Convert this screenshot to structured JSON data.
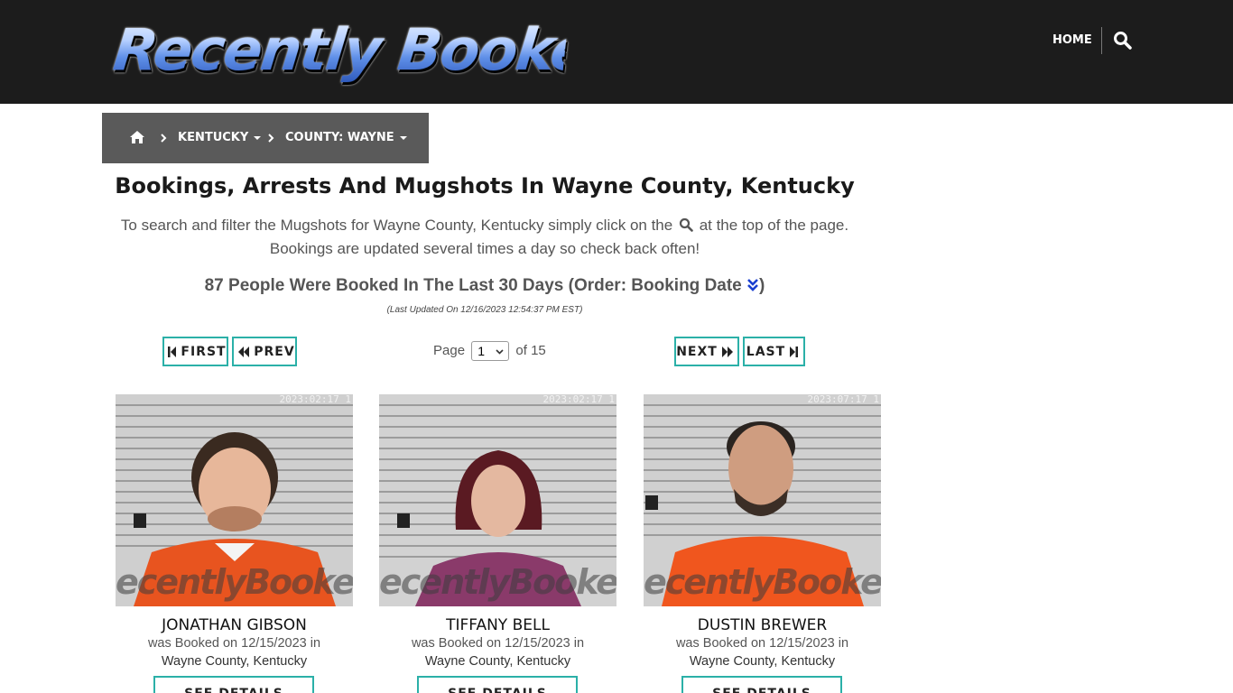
{
  "site": {
    "logo_text": "Recently Booked",
    "nav_home": "HOME"
  },
  "breadcrumb": {
    "state": "KENTUCKY",
    "county": "COUNTY: WAYNE"
  },
  "page": {
    "title": "Bookings, Arrests And Mugshots In Wayne County, Kentucky",
    "intro_part1": "To search and filter the Mugshots for Wayne County, Kentucky simply click on the",
    "intro_part2": "at the top of the page.",
    "intro_line2": "Bookings are updated several times a day so check back often!",
    "count_text": "87 People Were Booked In The Last 30 Days (Order: Booking Date",
    "count_close": ")",
    "last_updated": "(Last Updated On 12/16/2023 12:54:37 PM EST)"
  },
  "pager": {
    "first": "FIRST",
    "prev": "PREV",
    "next": "NEXT",
    "last": "LAST",
    "page_label": "Page",
    "current_page": "1",
    "of_label": "of 15"
  },
  "bookings": [
    {
      "name": "JONATHAN GIBSON",
      "booked_line": "was Booked on 12/15/2023 in",
      "location": "Wayne County, Kentucky",
      "details_label": "SEE DETAILS",
      "watermark": "ecentlyBooked.co",
      "timestamp": "2023:02:17 1",
      "shirt_color": "#e8541f"
    },
    {
      "name": "TIFFANY BELL",
      "booked_line": "was Booked on 12/15/2023 in",
      "location": "Wayne County, Kentucky",
      "details_label": "SEE DETAILS",
      "watermark": "ecentlyBooked.co",
      "timestamp": "2023:02:17 1",
      "shirt_color": "#8a3a6a"
    },
    {
      "name": "DUSTIN BREWER",
      "booked_line": "was Booked on 12/15/2023 in",
      "location": "Wayne County, Kentucky",
      "details_label": "SEE DETAILS",
      "watermark": "ecentlyBooked.co",
      "timestamp": "2023:07:17 1",
      "shirt_color": "#f0561e"
    }
  ],
  "colors": {
    "header_bg": "#1c1c1c",
    "breadcrumb_bg": "#5a5a5a",
    "button_border": "#2bb0a8",
    "order_arrow": "#1a3fd0"
  }
}
